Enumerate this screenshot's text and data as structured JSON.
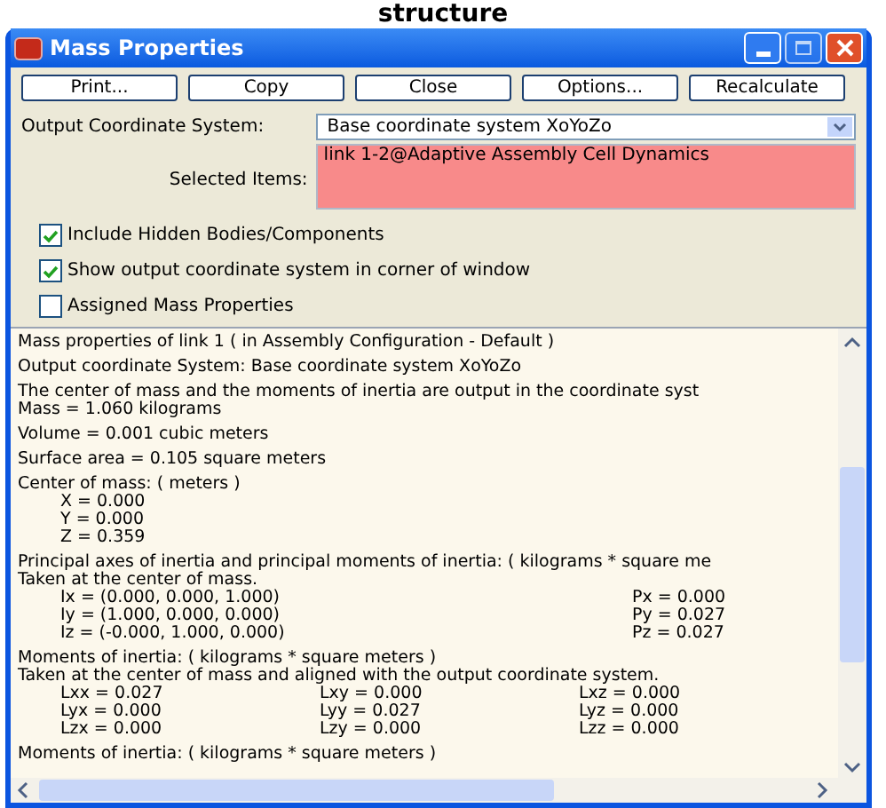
{
  "page_heading": "structure",
  "window": {
    "title": "Mass Properties"
  },
  "buttons": [
    "Print...",
    "Copy",
    "Close",
    "Options...",
    "Recalculate"
  ],
  "coordinate_system": {
    "label": "Output Coordinate System:",
    "value": "Base coordinate system XoYoZo"
  },
  "selected_items": {
    "label": "Selected Items:",
    "items": [
      "link 1-2@Adaptive Assembly Cell Dynamics"
    ]
  },
  "options": [
    {
      "label": "Include Hidden Bodies/Components",
      "checked": true
    },
    {
      "label": "Show output coordinate system in corner of window",
      "checked": true
    },
    {
      "label": "Assigned Mass Properties",
      "checked": false
    }
  ],
  "report": [
    [
      {
        "kind": "text",
        "text": "Mass properties of link 1 ( in Assembly Configuration - Default )"
      }
    ],
    [
      {
        "kind": "text",
        "text": "Output  coordinate System: Base coordinate system XoYoZo"
      }
    ],
    [
      {
        "kind": "text",
        "text": "The center of mass and the moments of inertia are output in the coordinate syst"
      },
      {
        "kind": "text",
        "text": "Mass = 1.060 kilograms"
      }
    ],
    [
      {
        "kind": "text",
        "text": "Volume = 0.001 cubic meters"
      }
    ],
    [
      {
        "kind": "text",
        "text": "Surface area = 0.105 square meters"
      }
    ],
    [
      {
        "kind": "text",
        "text": "Center of mass: ( meters )"
      },
      {
        "kind": "grid",
        "cells": [
          "X = 0.000"
        ]
      },
      {
        "kind": "grid",
        "cells": [
          "Y = 0.000"
        ]
      },
      {
        "kind": "grid",
        "cells": [
          "Z = 0.359"
        ]
      }
    ],
    [
      {
        "kind": "text",
        "text": "Principal axes of inertia and principal moments of inertia: ( kilograms * square me"
      },
      {
        "kind": "text",
        "text": "Taken at the center of mass."
      },
      {
        "kind": "axes",
        "cells": [
          "Ix = (0.000, 0.000, 1.000)",
          "Px = 0.000"
        ]
      },
      {
        "kind": "axes",
        "cells": [
          "Iy = (1.000, 0.000, 0.000)",
          "Py = 0.027"
        ]
      },
      {
        "kind": "axes",
        "cells": [
          "Iz = (-0.000, 1.000, 0.000)",
          "Pz = 0.027"
        ]
      }
    ],
    [
      {
        "kind": "text",
        "text": "Moments of inertia: ( kilograms * square meters )"
      },
      {
        "kind": "text",
        "text": "Taken at the center of mass and aligned with the output coordinate system."
      },
      {
        "kind": "grid",
        "cells": [
          "Lxx = 0.027",
          "Lxy = 0.000",
          "Lxz = 0.000"
        ]
      },
      {
        "kind": "grid",
        "cells": [
          "Lyx = 0.000",
          "Lyy = 0.027",
          "Lyz = 0.000"
        ]
      },
      {
        "kind": "grid",
        "cells": [
          "Lzx = 0.000",
          "Lzy = 0.000",
          "Lzz = 0.000"
        ]
      }
    ],
    [
      {
        "kind": "text",
        "text": "Moments of inertia: ( kilograms * square meters )"
      }
    ]
  ]
}
